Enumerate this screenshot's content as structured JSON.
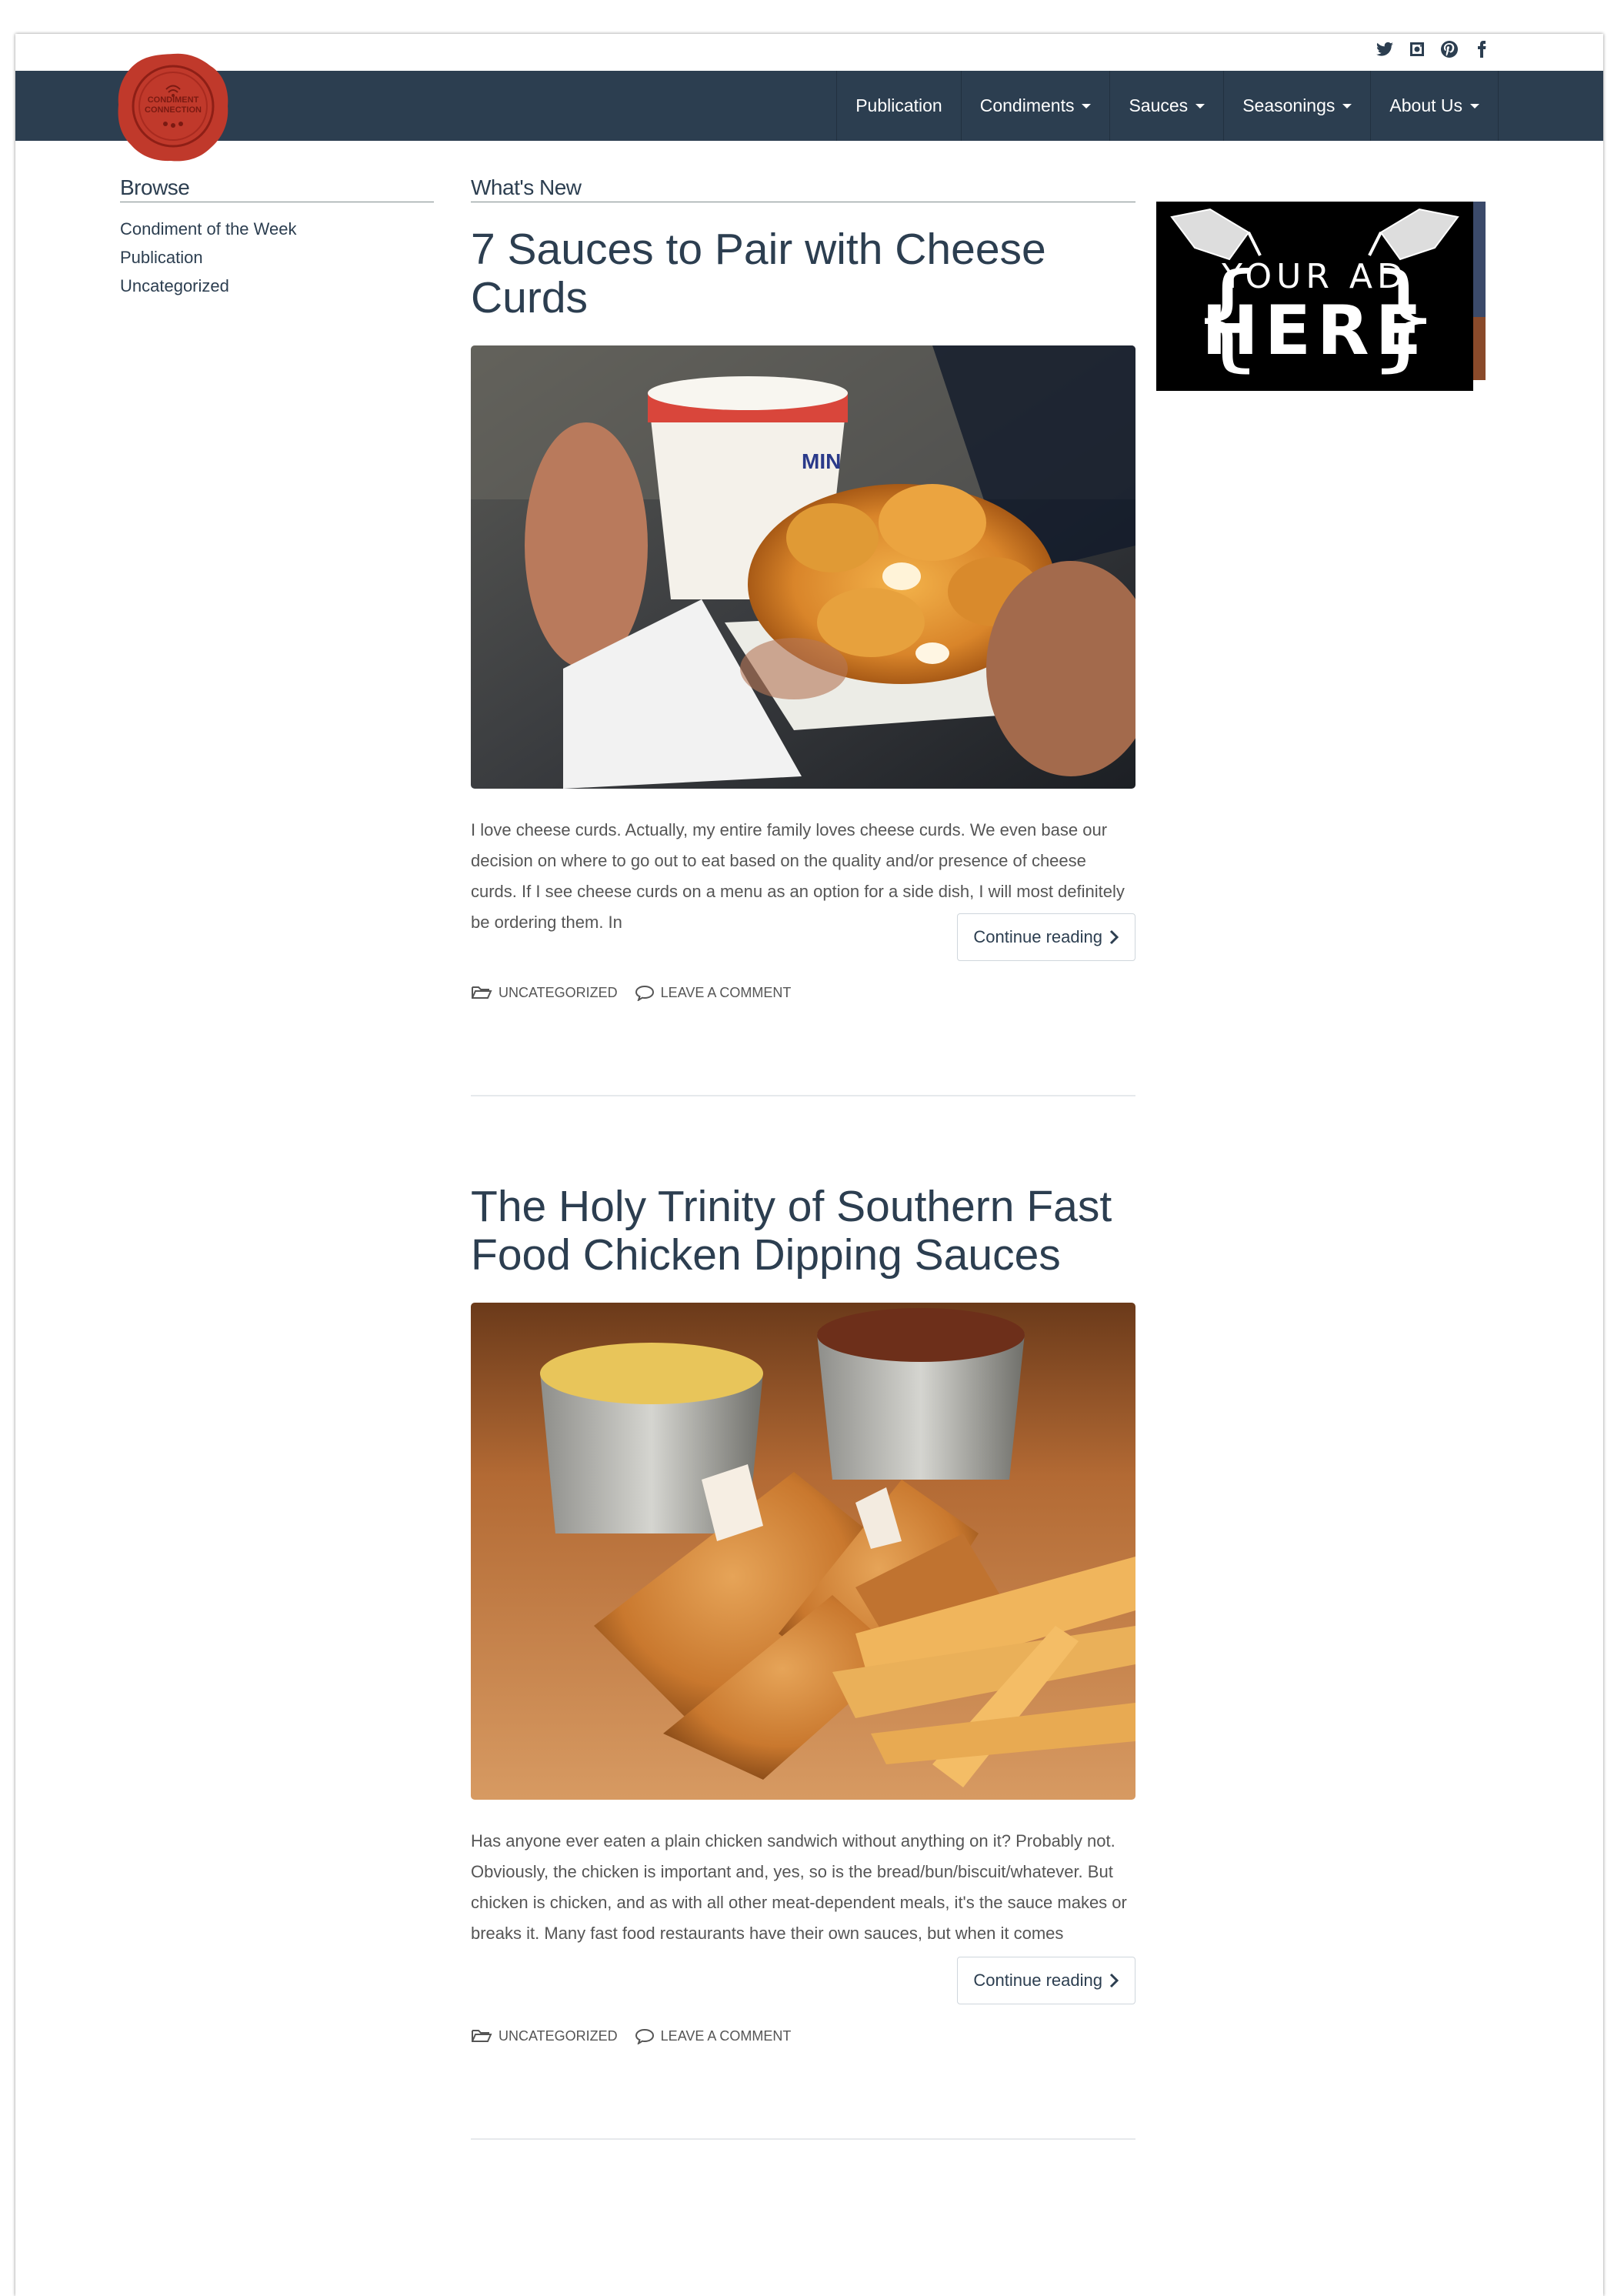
{
  "social": {
    "icons": [
      "twitter-icon",
      "instagram-icon",
      "pinterest-icon",
      "facebook-icon"
    ]
  },
  "logo": {
    "line1": "CONDIMENT",
    "line2": "CONNECTION",
    "color": "#c0392b"
  },
  "nav": {
    "items": [
      {
        "label": "Publication",
        "dropdown": false
      },
      {
        "label": "Condiments",
        "dropdown": true
      },
      {
        "label": "Sauces",
        "dropdown": true
      },
      {
        "label": "Seasonings",
        "dropdown": true
      },
      {
        "label": "About Us",
        "dropdown": true
      }
    ]
  },
  "sidebar": {
    "title": "Browse",
    "items": [
      "Condiment of the Week",
      "Publication",
      "Uncategorized"
    ]
  },
  "main": {
    "section_title": "What's New",
    "posts": [
      {
        "title": "7 Sauces to Pair with Cheese Curds",
        "excerpt": "I love cheese curds. Actually, my entire family loves cheese curds. We even base our decision on where to go out to eat based on the quality and/or presence of cheese curds. If I see cheese curds on a menu as an option for a side dish, I will most definitely be ordering them. In",
        "continue_label": "Continue reading",
        "category": "UNCATEGORIZED",
        "comment": "LEAVE A COMMENT"
      },
      {
        "title": "The Holy Trinity of Southern Fast Food Chicken Dipping Sauces",
        "excerpt": "Has anyone ever eaten a plain chicken sandwich without anything on it? Probably not. Obviously, the chicken is important and, yes, so is the bread/bun/biscuit/whatever. But chicken is chicken, and as with all other meat-dependent meals, it's the sauce makes or breaks it. Many fast food restaurants have their own sauces, but when it comes",
        "continue_label": "Continue reading",
        "category": "UNCATEGORIZED",
        "comment": "LEAVE A COMMENT"
      }
    ]
  },
  "ad": {
    "line1": "YOUR AD",
    "line2": "HERE"
  },
  "colors": {
    "navbar": "#2c3e50",
    "text": "#2c3e50",
    "brand_red": "#c0392b"
  }
}
